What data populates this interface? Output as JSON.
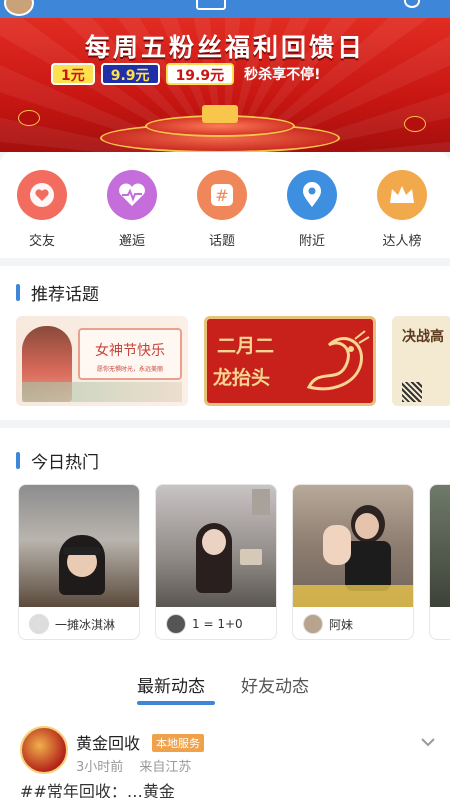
{
  "banner": {
    "headline": "每周五粉丝福利回馈日",
    "prices": [
      "1元",
      "9.9元",
      "19.9元"
    ],
    "tagline": "秒杀享不停!"
  },
  "quick_nav": [
    {
      "label": "交友",
      "icon": "heart-icon",
      "color": "#e9645d"
    },
    {
      "label": "邂逅",
      "icon": "heartbeat-icon",
      "color": "#c265d8"
    },
    {
      "label": "话题",
      "icon": "hashtag-icon",
      "color": "#ef8a5e"
    },
    {
      "label": "附近",
      "icon": "location-pin-icon",
      "color": "#3f8fe0"
    },
    {
      "label": "达人榜",
      "icon": "crown-icon",
      "color": "#f0a84a"
    }
  ],
  "topics": {
    "title": "推荐话题",
    "items": [
      {
        "title": "女神节快乐",
        "subtitle": "愿你无惧时光，永远美丽"
      },
      {
        "title": "二月二",
        "title2": "龙抬头"
      },
      {
        "title": "决战高"
      }
    ]
  },
  "hot": {
    "title": "今日热门",
    "cards": [
      {
        "name": "一摊冰淇淋"
      },
      {
        "name": "1 = 1+0"
      },
      {
        "name": "阿妹"
      }
    ]
  },
  "feed_tabs": {
    "latest": "最新动态",
    "friends": "好友动态"
  },
  "post": {
    "author": "黄金回收",
    "badge": "本地服务",
    "time": "3小时前",
    "source": "来自江苏",
    "preview": "##常年回收：…黄金"
  }
}
